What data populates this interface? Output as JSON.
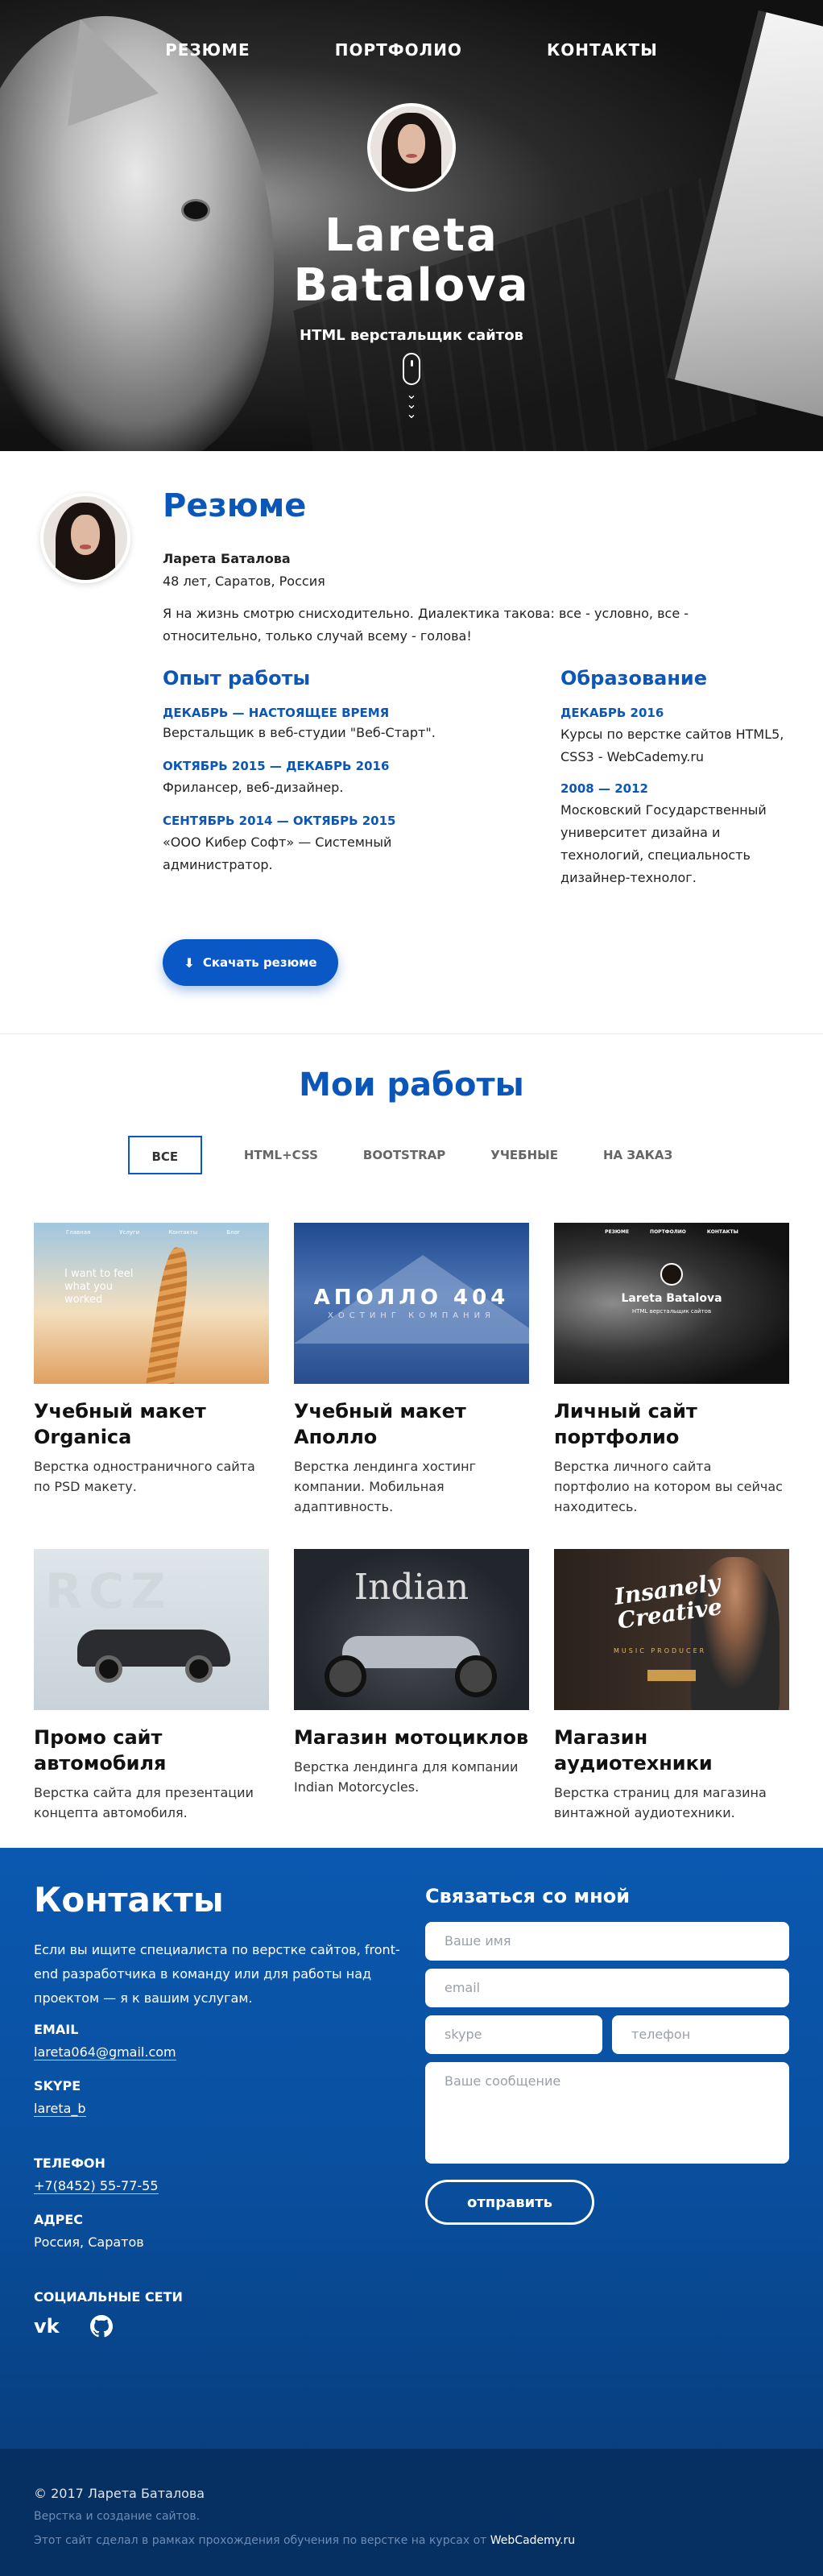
{
  "nav": {
    "items": [
      {
        "label": "РЕЗЮМЕ"
      },
      {
        "label": "ПОРТФОЛИО"
      },
      {
        "label": "КОНТАКТЫ"
      }
    ]
  },
  "hero": {
    "name_line1": "Lareta",
    "name_line2": "Batalova",
    "subtitle": "HTML верстальщик сайтов"
  },
  "resume": {
    "title": "Резюме",
    "full_name": "Ларета Баталова",
    "info": "48 лет, Саратов, Россия",
    "about": "Я на жизнь смотрю снисходительно. Диалектика такова: все - условно, все - относительно, только случай всему - голова!",
    "experience": {
      "title": "Опыт работы",
      "items": [
        {
          "date": "ДЕКАБРЬ — НАСТОЯЩЕЕ ВРЕМЯ",
          "text": "Верстальщик в веб-студии \"Веб-Старт\"."
        },
        {
          "date": "ОКТЯБРЬ 2015 — ДЕКАБРЬ 2016",
          "text": "Фрилансер, веб-дизайнер."
        },
        {
          "date": "СЕНТЯБРЬ 2014 — ОКТЯБРЬ 2015",
          "text": "«ООО Кибер Софт» — Системный администратор."
        }
      ]
    },
    "education": {
      "title": "Образование",
      "items": [
        {
          "date": "ДЕКАБРЬ 2016",
          "text": "Курсы по верстке сайтов HTML5, CSS3 - WebCademy.ru"
        },
        {
          "date": "2008 — 2012",
          "text": "Московский Государственный университет дизайна и технологий, специальность дизайнер-технолог."
        }
      ]
    },
    "download_label": "Скачать резюме"
  },
  "works": {
    "title": "Мои работы",
    "filters": [
      "ВСЕ",
      "HTML+CSS",
      "BOOTSTRAP",
      "УЧЕБНЫЕ",
      "НА ЗАКАЗ"
    ],
    "active_filter": "ВСЕ",
    "items": [
      {
        "title": "Учебный макет Organica",
        "desc": "Верстка одностраничного сайта по PSD макету.",
        "thumb_text": "I want to feel what you worked",
        "thumb_nav": [
          "Главная",
          "Услуги",
          "Контакты",
          "Блог"
        ]
      },
      {
        "title": "Учебный макет Аполло",
        "desc": "Верстка лендинга хостинг компании. Мобильная адаптивность.",
        "thumb_text": "АПОЛЛО 404",
        "thumb_sub": "ХОСТИНГ КОМПАНИЯ"
      },
      {
        "title": "Личный сайт портфолио",
        "desc": "Верстка личного сайта портфолио на котором вы сейчас находитесь.",
        "thumb_nav": [
          "РЕЗЮМЕ",
          "ПОРТФОЛИО",
          "КОНТАКТЫ"
        ],
        "thumb_text": "Lareta Batalova",
        "thumb_sub": "HTML верстальщик сайтов"
      },
      {
        "title": "Промо сайт автомобиля",
        "desc": "Верстка сайта для презентации концепта автомобиля.",
        "thumb_text": "RCZ"
      },
      {
        "title": "Магазин мотоциклов",
        "desc": "Верстка лендинга для компании Indian Motorcycles.",
        "thumb_text": "Indian"
      },
      {
        "title": "Магазин аудиотехники",
        "desc": "Верстка страниц для магазина винтажной аудиотехники.",
        "thumb_text": "Insanely Creative",
        "thumb_sub": "MUSIC PRODUCER"
      }
    ]
  },
  "contacts": {
    "title": "Контакты",
    "intro": "Если вы ищите специалиста по верстке сайтов, front-end разработчика в команду или для работы над проектом — я к вашим услугам.",
    "email_label": "EMAIL",
    "email": "lareta064@gmail.com",
    "skype_label": "SKYPE",
    "skype": "lareta_b",
    "phone_label": "ТЕЛЕФОН",
    "phone": "+7(8452) 55-77-55",
    "address_label": "АДРЕС",
    "address": "Россия, Саратов",
    "social_label": "СОЦИАЛЬНЫЕ СЕТИ",
    "social_icons": [
      "vk-icon",
      "github-icon"
    ],
    "form": {
      "title": "Связаться со мной",
      "name_placeholder": "Ваше имя",
      "email_placeholder": "email",
      "skype_placeholder": "skype",
      "phone_placeholder": "телефон",
      "message_placeholder": "Ваше сообщение",
      "submit_label": "отправить"
    }
  },
  "footer": {
    "copyright": "© 2017 Ларета Баталова",
    "line2": "Верстка и создание сайтов.",
    "line3": "Этот сайт сделал в рамках прохождения обучения по верстке на курсах от",
    "line3_link": "WebCademy.ru"
  },
  "colors": {
    "accent": "#0b57b9",
    "contacts_bg": "#0a58b0",
    "footer_bg": "#062f62"
  }
}
